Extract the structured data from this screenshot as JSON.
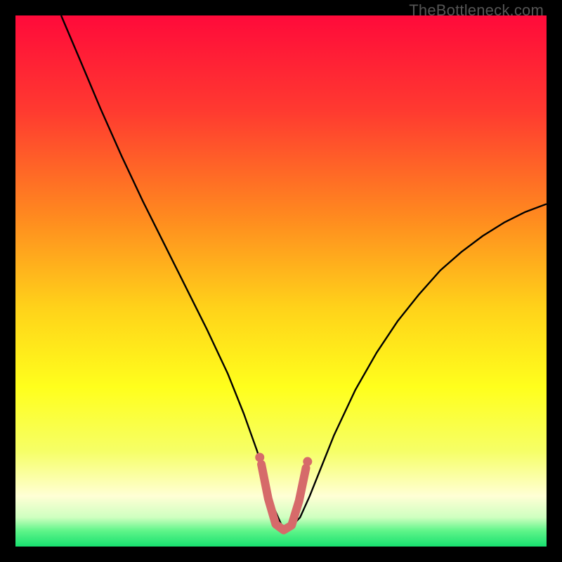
{
  "watermark": {
    "text": "TheBottleneck.com"
  },
  "chart_data": {
    "type": "line",
    "title": "",
    "xlabel": "",
    "ylabel": "",
    "xlim": [
      0,
      100
    ],
    "ylim": [
      0,
      100
    ],
    "background": {
      "type": "vertical-gradient",
      "stops": [
        {
          "offset": 0.0,
          "color": "#ff0a3a"
        },
        {
          "offset": 0.18,
          "color": "#ff3a30"
        },
        {
          "offset": 0.38,
          "color": "#ff8a1f"
        },
        {
          "offset": 0.55,
          "color": "#ffd21a"
        },
        {
          "offset": 0.7,
          "color": "#ffff1c"
        },
        {
          "offset": 0.82,
          "color": "#f6ff66"
        },
        {
          "offset": 0.905,
          "color": "#ffffd5"
        },
        {
          "offset": 0.945,
          "color": "#cfffc0"
        },
        {
          "offset": 0.97,
          "color": "#60f58a"
        },
        {
          "offset": 1.0,
          "color": "#17e06f"
        }
      ]
    },
    "series": [
      {
        "name": "bottleneck-curve",
        "color": "#000000",
        "width": 2.4,
        "x": [
          8.6,
          12,
          16,
          20,
          24,
          28,
          32,
          36,
          40,
          43,
          45.5,
          47.3,
          48.8,
          50.2,
          51.8,
          53.6,
          55.4,
          57.4,
          60,
          64,
          68,
          72,
          76,
          80,
          84,
          88,
          92,
          96,
          100
        ],
        "y": [
          100,
          92,
          82.5,
          73.5,
          65,
          57,
          49,
          41,
          32.5,
          25,
          18,
          12,
          7,
          3.8,
          3.6,
          5.5,
          9.5,
          14.5,
          21,
          29.5,
          36.5,
          42.5,
          47.5,
          52,
          55.5,
          58.5,
          61,
          63,
          64.5
        ]
      },
      {
        "name": "optimal-zone-highlight",
        "color": "#d66a6a",
        "width": 12,
        "linecap": "round",
        "x": [
          46.3,
          47.6,
          49.0,
          50.5,
          52.0,
          53.4,
          54.7
        ],
        "y": [
          15.5,
          9.0,
          4.2,
          3.1,
          4.0,
          8.6,
          14.8
        ]
      }
    ],
    "markers": [
      {
        "x": 46.0,
        "y": 16.8,
        "r": 6.5,
        "color": "#d66a6a"
      },
      {
        "x": 55.0,
        "y": 16.0,
        "r": 6.5,
        "color": "#d66a6a"
      }
    ]
  }
}
